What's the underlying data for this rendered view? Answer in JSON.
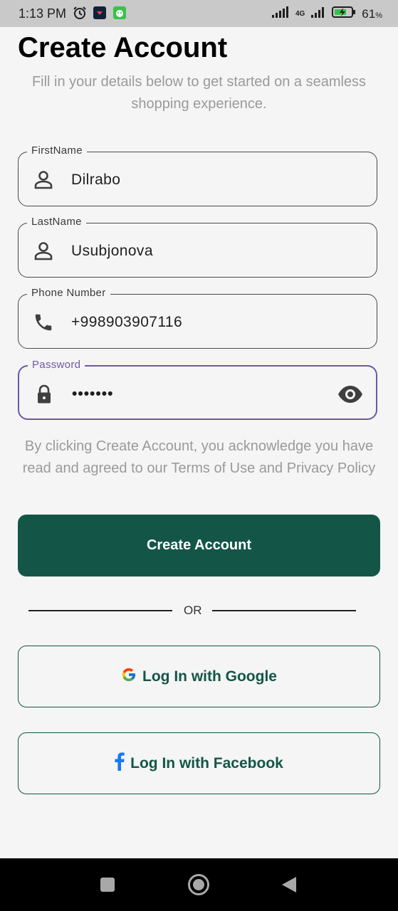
{
  "status_bar": {
    "time": "1:13 PM",
    "network": "4G",
    "battery": "61"
  },
  "page": {
    "title": "Create Account",
    "subtitle": "Fill in your details below to get started on a seamless shopping experience."
  },
  "form": {
    "first_name": {
      "label": "FirstName",
      "value": "Dilrabo",
      "icon": "person-icon"
    },
    "last_name": {
      "label": "LastName",
      "value": "Usubjonova",
      "icon": "person-icon"
    },
    "phone": {
      "label": "Phone Number",
      "value": "+998903907116",
      "icon": "phone-icon"
    },
    "password": {
      "label": "Password",
      "value": "•••••••",
      "icon": "lock-icon"
    }
  },
  "terms_text": "By clicking Create Account, you acknowledge you have read and agreed to our Terms of Use and Privacy Policy",
  "actions": {
    "create_account": "Create Account",
    "or": "OR",
    "google": "Log In with Google",
    "facebook": "Log In with Facebook"
  },
  "colors": {
    "primary": "#135647",
    "focus": "#6b58a8",
    "muted_text": "#9a9a9a"
  }
}
